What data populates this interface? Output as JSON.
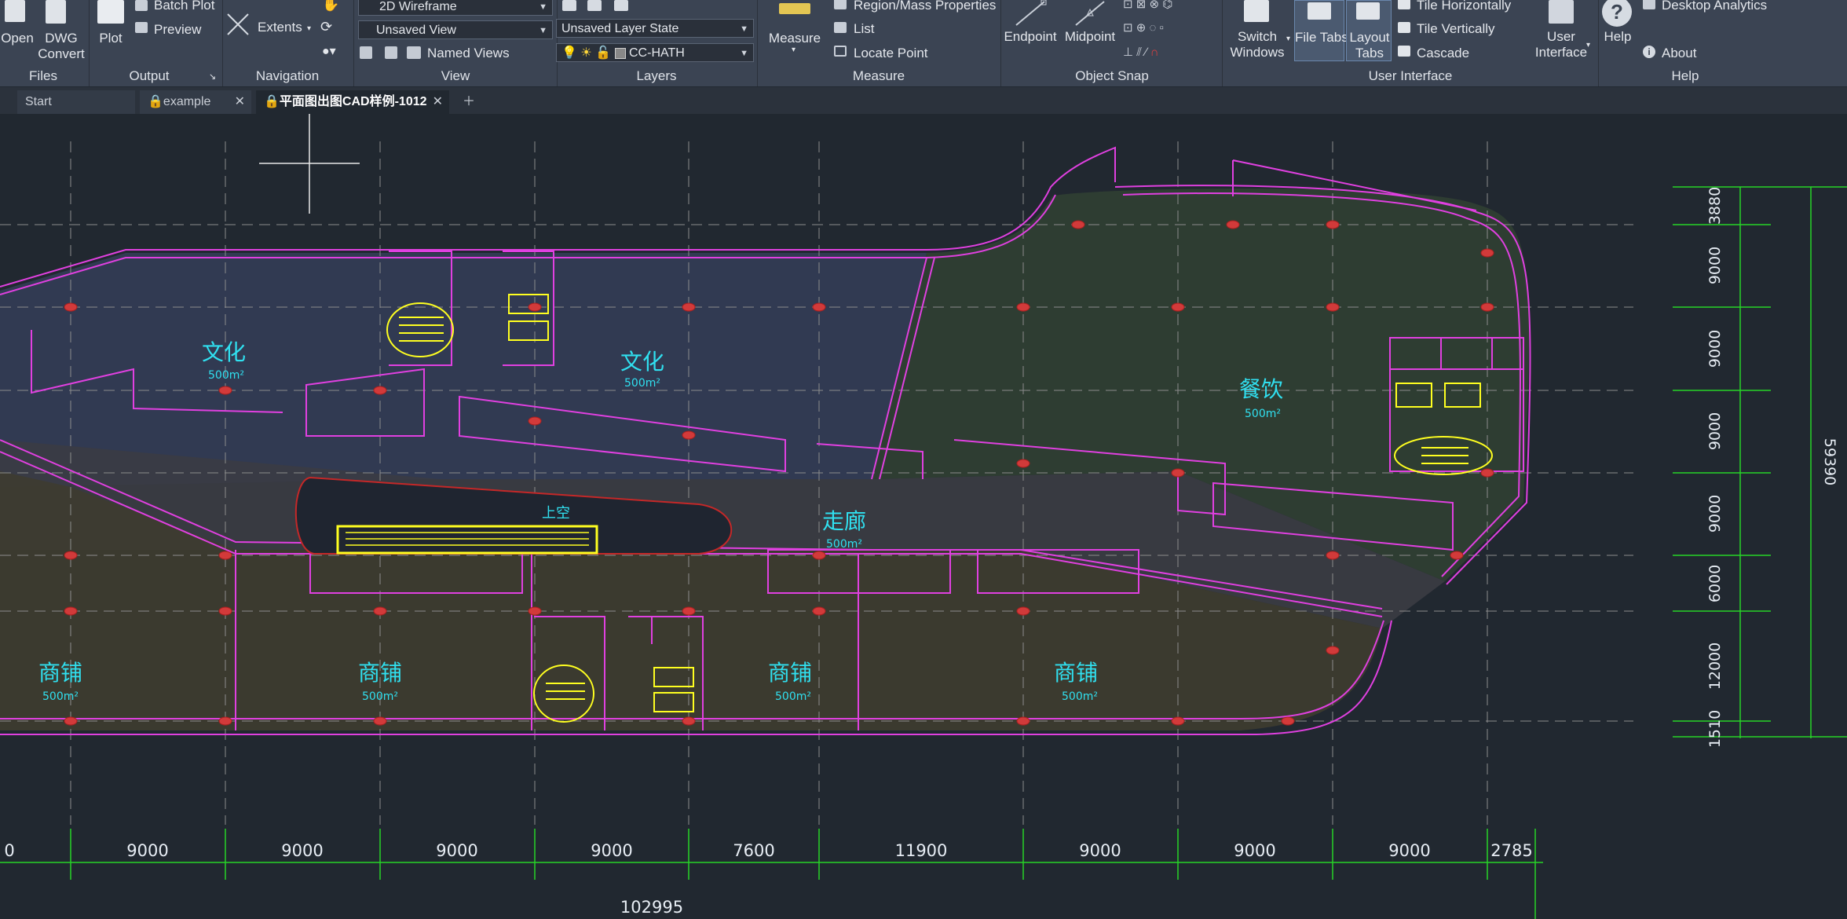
{
  "ribbon": {
    "files": {
      "open": "Open",
      "dwg_convert": "DWG\nConvert",
      "group": "Files"
    },
    "output": {
      "plot": "Plot",
      "batch_plot": "Batch Plot",
      "preview": "Preview",
      "group": "Output"
    },
    "navigation": {
      "extents": "Extents",
      "group": "Navigation"
    },
    "view": {
      "visual_style": "2D Wireframe",
      "view_select": "Unsaved View",
      "named_views": "Named Views",
      "group": "View"
    },
    "layers": {
      "layer_state": "Unsaved Layer State",
      "current_layer": "CC-HATH",
      "group": "Layers"
    },
    "measure": {
      "measure": "Measure",
      "region_mass": "Region/Mass Properties",
      "list": "List",
      "locate_point": "Locate Point",
      "group": "Measure"
    },
    "object_snap": {
      "endpoint": "Endpoint",
      "midpoint": "Midpoint",
      "group": "Object Snap"
    },
    "user_interface": {
      "switch_windows": "Switch\nWindows",
      "file_tabs": "File Tabs",
      "layout_tabs": "Layout\nTabs",
      "tile_horizontally": "Tile Horizontally",
      "tile_vertically": "Tile Vertically",
      "cascade": "Cascade",
      "user_interface": "User\nInterface",
      "group": "User Interface"
    },
    "help": {
      "help": "Help",
      "desktop_analytics": "Desktop Analytics",
      "about": "About",
      "group": "Help"
    }
  },
  "tabs": [
    {
      "label": "Start",
      "active": false,
      "locked": false
    },
    {
      "label": "example",
      "active": false,
      "locked": true
    },
    {
      "label": "平面图出图CAD样例-1012",
      "active": true,
      "locked": true
    }
  ],
  "drawing": {
    "rooms": [
      {
        "name": "文化",
        "area": "500m²"
      },
      {
        "name": "文化",
        "area": "500m²"
      },
      {
        "name": "餐饮",
        "area": "500m²"
      },
      {
        "name": "走廊",
        "area": "500m²"
      },
      {
        "name": "商铺",
        "area": "500m²"
      },
      {
        "name": "商铺",
        "area": "500m²"
      },
      {
        "name": "商铺",
        "area": "500m²"
      },
      {
        "name": "商铺",
        "area": "500m²"
      }
    ],
    "void_label": "上空",
    "bottom_dims": [
      "0",
      "9000",
      "9000",
      "9000",
      "9000",
      "7600",
      "11900",
      "9000",
      "9000",
      "9000",
      "2785"
    ],
    "total_dim": "102995",
    "right_dims": [
      "3880",
      "9000",
      "9000",
      "9000",
      "9000",
      "6000",
      "12000",
      "1510"
    ],
    "right_total": "59390",
    "colors": {
      "outline": "#e040e0",
      "grid": "#8c8c8c",
      "dim": "#27d427",
      "text": "#30e0f0",
      "stair": "#ffff20",
      "culture_fill": "#343d58",
      "food_fill": "#303f33",
      "shop_fill": "#3e3c30"
    }
  }
}
